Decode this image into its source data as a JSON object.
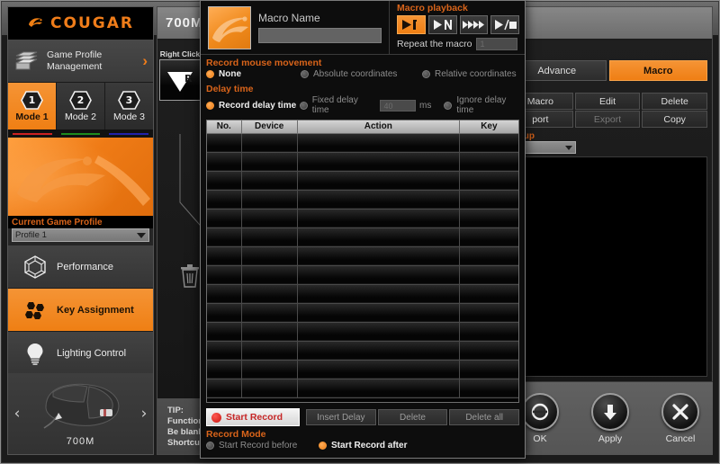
{
  "window": {
    "minimize_label": "—",
    "close_label": "✕"
  },
  "sidebar": {
    "brand": "COUGAR",
    "game_profile": {
      "label": "Game Profile\nManagement",
      "arrow": "›"
    },
    "modes": [
      {
        "num": "1",
        "label": "Mode 1",
        "color": "#cc2222",
        "active": true
      },
      {
        "num": "2",
        "label": "Mode 2",
        "color": "#1e8c1e",
        "active": false
      },
      {
        "num": "3",
        "label": "Mode 3",
        "color": "#2222aa",
        "active": false
      }
    ],
    "current_profile_label": "Current Game Profile",
    "current_profile_value": "Profile 1",
    "nav": [
      {
        "label": "Performance",
        "icon": "performance-icon",
        "active": false
      },
      {
        "label": "Key Assignment",
        "icon": "key-assignment-icon",
        "active": true
      },
      {
        "label": "Lighting Control",
        "icon": "lighting-control-icon",
        "active": false
      }
    ],
    "device": {
      "name": "700M",
      "prev": "‹",
      "next": "›"
    }
  },
  "keymap": {
    "device_title": "700M",
    "callout": {
      "caption": "Right Click",
      "glyph": "R"
    },
    "tip": {
      "line1": "TIP:",
      "line2": "Function set",
      "line3": "Be blank key",
      "line4": "Shortcut set"
    }
  },
  "right_panel": {
    "tabs": [
      {
        "label": "Advance",
        "active": false
      },
      {
        "label": "Macro",
        "active": true
      }
    ],
    "buttons_row1": [
      {
        "label": "Macro",
        "disabled": false
      },
      {
        "label": "Edit",
        "disabled": false
      },
      {
        "label": "Delete",
        "disabled": false
      }
    ],
    "buttons_row2": [
      {
        "label": "port",
        "disabled": false
      },
      {
        "label": "Export",
        "disabled": true
      },
      {
        "label": "Copy",
        "disabled": false
      }
    ],
    "group_label": "Group",
    "group_value": "",
    "footer": [
      {
        "label": "OK",
        "icon": "ok-circle-icon"
      },
      {
        "label": "Apply",
        "icon": "apply-down-arrow-icon"
      },
      {
        "label": "Cancel",
        "icon": "cancel-x-icon"
      }
    ]
  },
  "dialog": {
    "macro_name_label": "Macro Name",
    "macro_name_value": "",
    "playback": {
      "title": "Macro playback",
      "buttons": [
        {
          "icon": "play-once-icon",
          "glyph": "▶1",
          "active": true
        },
        {
          "icon": "play-n-times-icon",
          "glyph": "▶N",
          "active": false
        },
        {
          "icon": "play-loop-icon",
          "glyph": "▶▶▶▶",
          "active": false
        },
        {
          "icon": "play-toggle-icon",
          "glyph": "▶/■",
          "active": false
        }
      ],
      "repeat_label": "Repeat the macro",
      "repeat_value": "1"
    },
    "record_mouse_movement": {
      "title": "Record mouse movement",
      "options": [
        {
          "label": "None",
          "selected": true
        },
        {
          "label": "Absolute coordinates",
          "selected": false
        },
        {
          "label": "Relative coordinates",
          "selected": false
        }
      ]
    },
    "delay_time": {
      "title": "Delay time",
      "record_delay": {
        "label": "Record delay time",
        "selected": true
      },
      "fixed_delay": {
        "label": "Fixed delay time",
        "selected": false,
        "value": "40",
        "unit": "ms"
      },
      "ignore_delay": {
        "label": "Ignore delay time",
        "selected": false
      }
    },
    "table": {
      "columns": [
        "No.",
        "Device",
        "Action",
        "Key"
      ],
      "rows": [],
      "empty_row_count": 14
    },
    "start_record_button": "Start Record",
    "action_buttons": [
      {
        "label": "Insert Delay"
      },
      {
        "label": "Delete"
      },
      {
        "label": "Delete all"
      }
    ],
    "record_mode": {
      "title": "Record Mode",
      "options": [
        {
          "label": "Start Record before",
          "selected": false
        },
        {
          "label": "Start Record after",
          "selected": true
        }
      ]
    }
  },
  "colors": {
    "accent": "#ef7f14",
    "accent_text": "#d9641a",
    "panel_bg": "#1b1b1b",
    "record_red": "#c62626"
  }
}
